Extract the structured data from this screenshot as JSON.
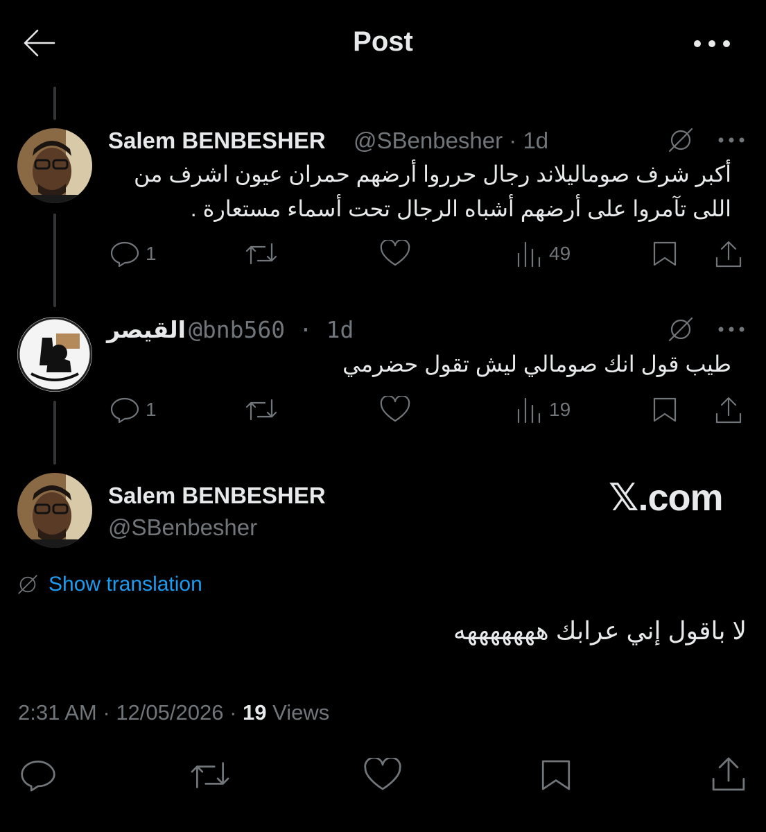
{
  "header": {
    "title": "Post"
  },
  "tweets": [
    {
      "name": "Salem BENBESHER",
      "handle_time": "@SBenbesher · 1d",
      "text_lines": [
        "أكبر شرف صوماليلاند رجال حرروا أرضهم حمران عيون اشرف من",
        "اللى تآمروا على أرضهم أشباه الرجال تحت أسماء مستعارة ."
      ],
      "replies": "1",
      "views": "49"
    },
    {
      "name": "القيصر",
      "handle_time": "@bnb560 · 1d",
      "text_lines": [
        "طيب قول انك صومالي ليش تقول حضرمي"
      ],
      "replies": "1",
      "views": "19"
    }
  ],
  "main": {
    "name": "Salem BENBESHER",
    "handle": "@SBenbesher",
    "watermark": "𝕏.com",
    "show_translation": "Show translation",
    "text": "لا باقول إني عرابك هههههههه",
    "time": "2:31 AM",
    "date": "12/05/2026",
    "views_count": "19",
    "views_label": "Views"
  },
  "colors": {
    "background": "#000000",
    "text": "#e7e9ea",
    "muted": "#71767b",
    "link": "#1d9bf0"
  }
}
